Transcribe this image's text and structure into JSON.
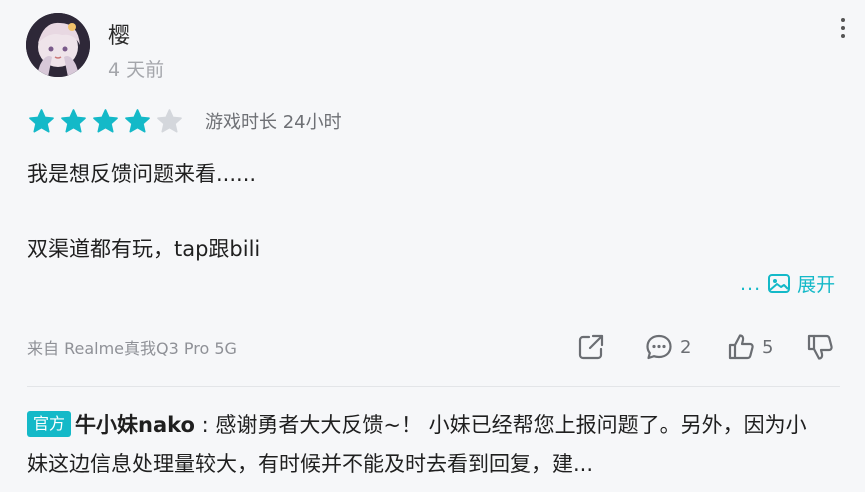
{
  "review": {
    "username": "樱",
    "time_ago": "4 天前",
    "rating": 4,
    "rating_max": 5,
    "playtime": "游戏时长 24小时",
    "lines": [
      "我是想反馈问题来看......",
      "双渠道都有玩，tap跟bili"
    ],
    "expand_dots": "...",
    "expand_label": "展开",
    "device": "来自 Realme真我Q3 Pro 5G"
  },
  "actions": {
    "comment_count": "2",
    "like_count": "5"
  },
  "reply": {
    "badge": "官方",
    "author": "牛小妹nako",
    "separator": " : ",
    "text": "感谢勇者大大反馈~！ 小妹已经帮您上报问题了。另外，因为小妹这边信息处理量较大，有时候并不能及时去看到回复，建..."
  },
  "colors": {
    "accent": "#14b9c8",
    "star_filled": "#14b9c8",
    "star_empty": "#d4d7dc"
  },
  "icons": {
    "more": "more-vertical-icon",
    "expand": "image-icon",
    "share": "share-icon",
    "comment": "comment-icon",
    "like": "thumbs-up-icon",
    "dislike": "thumbs-down-icon"
  }
}
